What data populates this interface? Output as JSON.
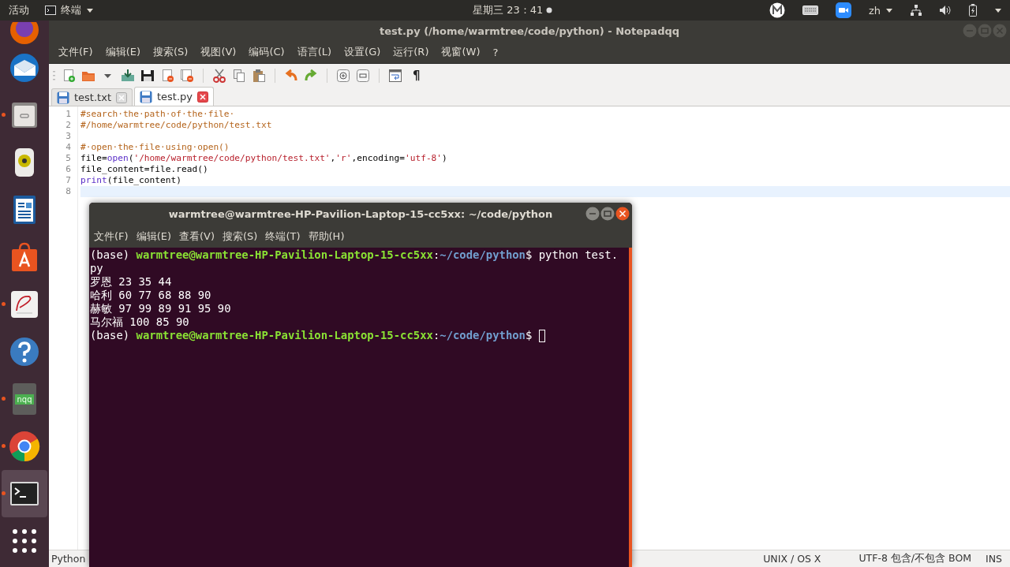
{
  "top_bar": {
    "activities": "活动",
    "app_menu": "终端",
    "clock": "星期三 23：41",
    "language": "zh"
  },
  "dock": {
    "items": [
      {
        "kind": "firefox",
        "running": false,
        "selected": false
      },
      {
        "kind": "thunderbird",
        "running": false,
        "selected": false
      },
      {
        "kind": "files",
        "running": true,
        "selected": false
      },
      {
        "kind": "speaker",
        "running": false,
        "selected": false
      },
      {
        "kind": "writer",
        "running": false,
        "selected": false
      },
      {
        "kind": "store",
        "running": false,
        "selected": false
      },
      {
        "kind": "document-viewer",
        "running": true,
        "selected": false
      },
      {
        "kind": "help",
        "running": false,
        "selected": false
      },
      {
        "kind": "nqq",
        "running": true,
        "selected": false,
        "label": "nqq"
      },
      {
        "kind": "chrome",
        "running": true,
        "selected": false
      },
      {
        "kind": "terminal",
        "running": true,
        "selected": true
      },
      {
        "kind": "app-grid",
        "running": false,
        "selected": false
      }
    ]
  },
  "editor_window": {
    "title": "test.py (/home/warmtree/code/python) - Notepadqq",
    "menu": [
      "文件(F)",
      "编辑(E)",
      "搜索(S)",
      "视图(V)",
      "编码(C)",
      "语言(L)",
      "设置(G)",
      "运行(R)",
      "视窗(W)",
      "?"
    ],
    "toolbar": {
      "pilcrow": "¶"
    },
    "tabs": [
      {
        "label": "test.txt",
        "selected": false
      },
      {
        "label": "test.py",
        "selected": true
      }
    ],
    "lines": [
      {
        "number": "1",
        "current": false,
        "tokens": [
          {
            "kind": "comment",
            "text": "#search·the·path·of·the·file·"
          }
        ]
      },
      {
        "number": "2",
        "current": false,
        "tokens": [
          {
            "kind": "comment",
            "text": "#/home/warmtree/code/python/test.txt"
          }
        ]
      },
      {
        "number": "3",
        "current": false
      },
      {
        "number": "4",
        "current": false,
        "tokens": [
          {
            "kind": "comment",
            "text": "#·open·the·file·using·open()"
          }
        ]
      },
      {
        "number": "5",
        "current": false,
        "tokens": [
          {
            "kind": "plain",
            "text": "file="
          },
          {
            "kind": "builtin",
            "text": "open"
          },
          {
            "kind": "plain",
            "text": "("
          },
          {
            "kind": "string",
            "text": "'/home/warmtree/code/python/test.txt'"
          },
          {
            "kind": "plain",
            "text": ","
          },
          {
            "kind": "string",
            "text": "'r'"
          },
          {
            "kind": "plain",
            "text": ",encoding="
          },
          {
            "kind": "string",
            "text": "'utf-8'"
          },
          {
            "kind": "plain",
            "text": ")"
          }
        ]
      },
      {
        "number": "6",
        "current": false,
        "tokens": [
          {
            "kind": "plain",
            "text": "file_content=file.read()"
          }
        ]
      },
      {
        "number": "7",
        "current": false,
        "tokens": [
          {
            "kind": "builtin",
            "text": "print"
          },
          {
            "kind": "plain",
            "text": "(file_content)"
          }
        ]
      },
      {
        "number": "8",
        "current": true
      }
    ],
    "status_bar": {
      "language": "Python",
      "line_endings": "UNIX / OS X",
      "encoding": "UTF-8 包含/不包含 BOM",
      "mode": "INS"
    }
  },
  "terminal_window": {
    "title": "warmtree@warmtree-HP-Pavilion-Laptop-15-cc5xx: ~/code/python",
    "menu": [
      "文件(F)",
      "编辑(E)",
      "查看(V)",
      "搜索(S)",
      "终端(T)",
      "帮助(H)"
    ],
    "lines": [
      {
        "tokens": [
          {
            "kind": "plain",
            "text": "(base) "
          },
          {
            "kind": "user",
            "text": "warmtree@warmtree-HP-Pavilion-Laptop-15-cc5xx"
          },
          {
            "kind": "plain",
            "text": ":"
          },
          {
            "kind": "path",
            "text": "~/code/python"
          },
          {
            "kind": "plain",
            "text": "$ python test."
          }
        ],
        "cursor": false
      },
      {
        "tokens": [
          {
            "kind": "plain",
            "text": "py"
          }
        ],
        "cursor": false
      },
      {
        "tokens": [
          {
            "kind": "plain",
            "text": "罗恩 23 35 44"
          }
        ],
        "cursor": false
      },
      {
        "tokens": [
          {
            "kind": "plain",
            "text": "哈利 60 77 68 88 90"
          }
        ],
        "cursor": false
      },
      {
        "tokens": [
          {
            "kind": "plain",
            "text": "赫敏 97 99 89 91 95 90"
          }
        ],
        "cursor": false
      },
      {
        "tokens": [
          {
            "kind": "plain",
            "text": "马尔福 100 85 90"
          }
        ],
        "cursor": false
      },
      {
        "tokens": [
          {
            "kind": "plain",
            "text": "(base) "
          },
          {
            "kind": "user",
            "text": "warmtree@warmtree-HP-Pavilion-Laptop-15-cc5xx"
          },
          {
            "kind": "plain",
            "text": ":"
          },
          {
            "kind": "path",
            "text": "~/code/python"
          },
          {
            "kind": "plain",
            "text": "$ "
          }
        ],
        "cursor": true
      }
    ]
  }
}
